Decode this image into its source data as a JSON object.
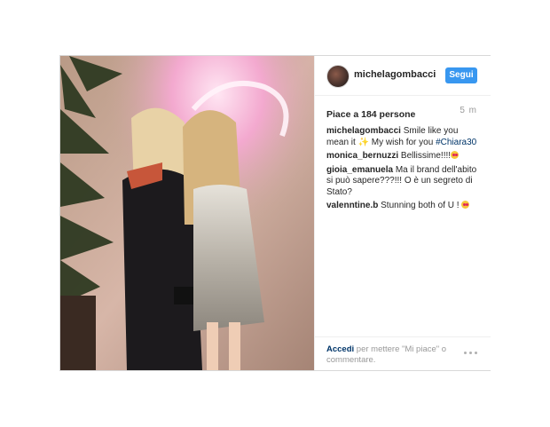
{
  "post": {
    "username": "michelagombacci",
    "follow_label": "Segui",
    "likes": "Piace a 184 persone",
    "time": "5 m",
    "comments": [
      {
        "author": "michelagombacci",
        "text_before": "Smile like you mean it ",
        "text_mid": " My wish for you ",
        "hashtag": "#Chiara30"
      },
      {
        "author": "monica_bernuzzi",
        "text": "Bellissime!!!!"
      },
      {
        "author": "gioia_emanuela",
        "text": "Ma il brand dell'abito si può sapere???!!! O è un segreto di Stato?"
      },
      {
        "author": "valenntine.b",
        "text": "Stunning both of U ! "
      }
    ],
    "footer": {
      "login_link": "Accedi",
      "text": " per mettere \"Mi piace\" o commentare."
    },
    "icons": [
      "avatar",
      "sparkle-emoji",
      "heart-eyes-emoji",
      "more-options-icon"
    ],
    "colors": {
      "follow_button": "#3897f0",
      "hashtag": "#003569",
      "muted": "#999999"
    }
  }
}
